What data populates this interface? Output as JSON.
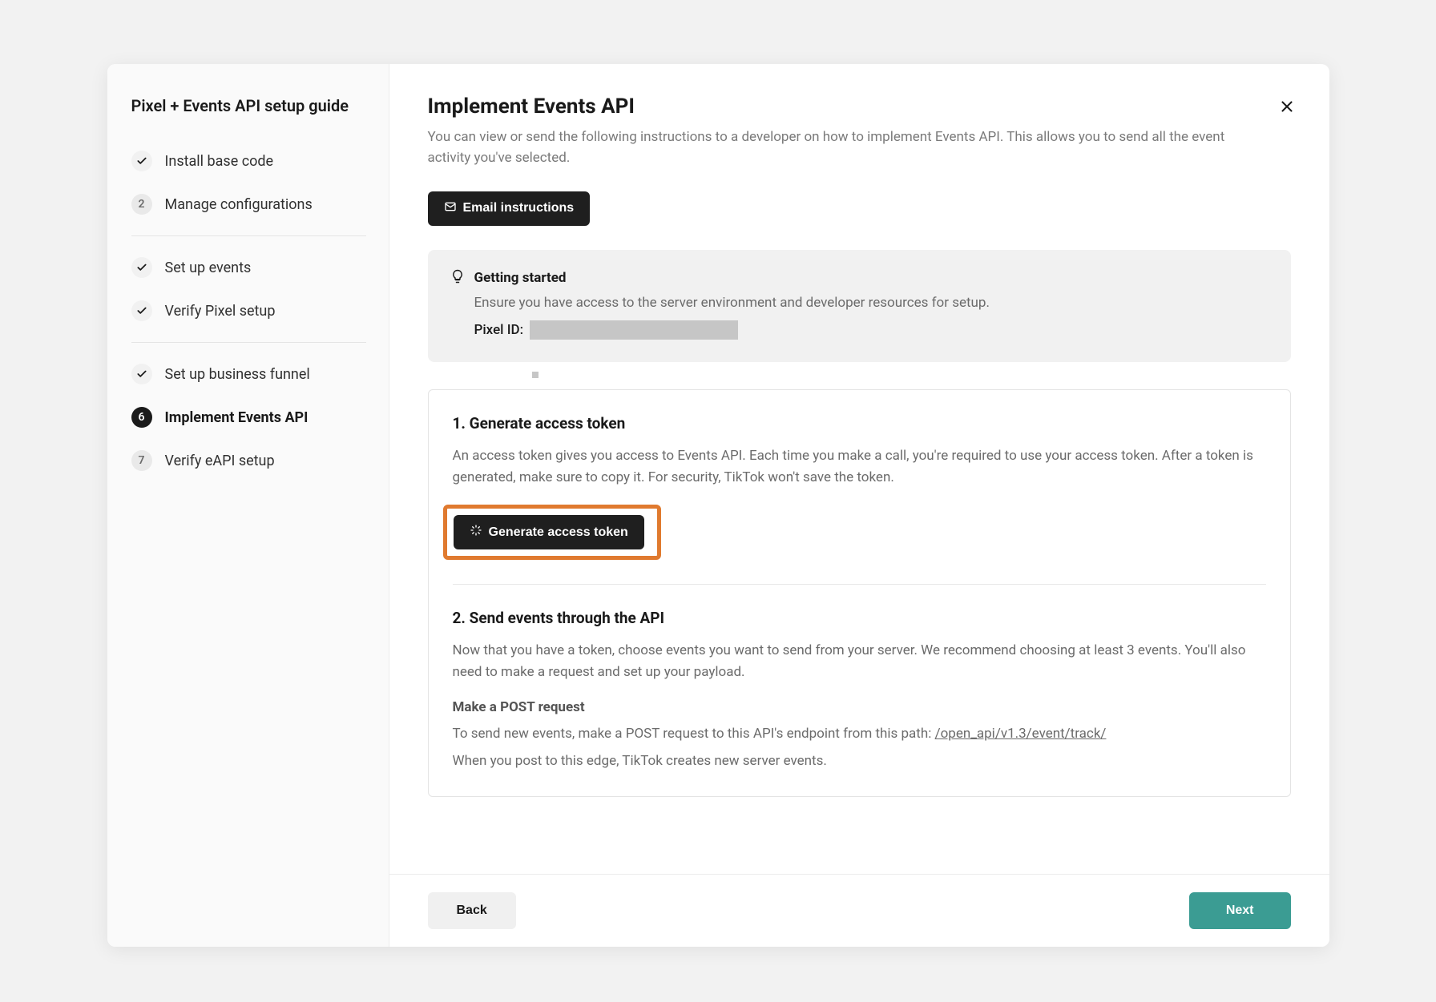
{
  "sidebar": {
    "title": "Pixel + Events API setup guide",
    "steps": [
      {
        "label": "Install base code",
        "type": "check"
      },
      {
        "label": "Manage configurations",
        "type": "number",
        "num": "2"
      },
      {
        "label": "Set up events",
        "type": "check"
      },
      {
        "label": "Verify Pixel setup",
        "type": "check"
      },
      {
        "label": "Set up business funnel",
        "type": "check"
      },
      {
        "label": "Implement Events API",
        "type": "active",
        "num": "6"
      },
      {
        "label": "Verify eAPI setup",
        "type": "number",
        "num": "7"
      }
    ]
  },
  "header": {
    "title": "Implement Events API",
    "desc": "You can view or send the following instructions to a developer on how to implement Events API. This allows you to send all the event activity you've selected."
  },
  "buttons": {
    "email": "Email instructions",
    "generate": "Generate access token",
    "back": "Back",
    "next": "Next"
  },
  "gettingStarted": {
    "title": "Getting started",
    "text": "Ensure you have access to the server environment and developer resources for setup.",
    "pixelLabel": "Pixel ID:"
  },
  "section1": {
    "title": "1. Generate access token",
    "text": "An access token gives you access to Events API. Each time you make a call, you're required to use your access token. After a token is generated, make sure to copy it. For security, TikTok won't save the token."
  },
  "section2": {
    "title": "2. Send events through the API",
    "text": "Now that you have a token, choose events you want to send from your server. We recommend choosing at least 3 events. You'll also need to make a request and set up your payload.",
    "subheading": "Make a POST request",
    "postText1": "To send new events, make a POST request to this API's endpoint from this path: ",
    "apiPath": "/open_api/v1.3/event/track/",
    "postText2": "When you post to this edge, TikTok creates new server events."
  }
}
